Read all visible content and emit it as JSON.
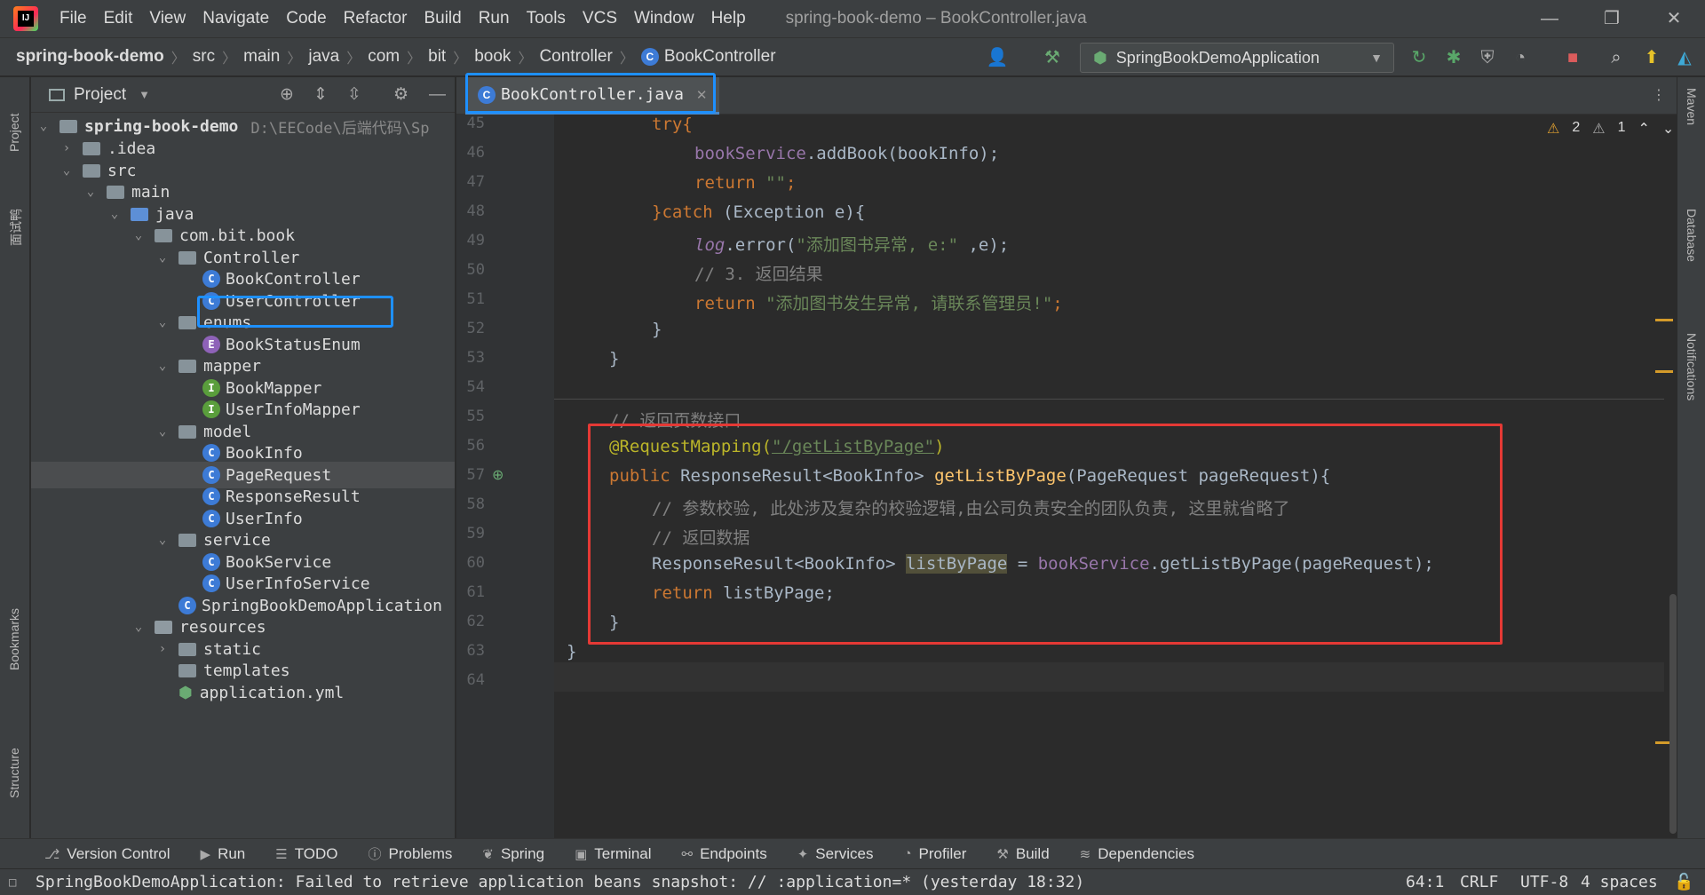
{
  "app": {
    "logo_text": "IJ",
    "window_title": "spring-book-demo – BookController.java"
  },
  "menu": [
    "File",
    "Edit",
    "View",
    "Navigate",
    "Code",
    "Refactor",
    "Build",
    "Run",
    "Tools",
    "VCS",
    "Window",
    "Help"
  ],
  "window_controls": {
    "minimize": "—",
    "restore": "❐",
    "close": "✕"
  },
  "breadcrumbs": [
    "spring-book-demo",
    "src",
    "main",
    "java",
    "com",
    "bit",
    "book",
    "Controller",
    "BookController"
  ],
  "run_config": "SpringBookDemoApplication",
  "left_strip": {
    "project": "Project",
    "bookmarks": "Bookmarks",
    "structure": "Structure",
    "extra": "面试鸭"
  },
  "right_strip": {
    "maven": "Maven",
    "database": "Database",
    "notifications": "Notifications"
  },
  "project_panel": {
    "title": "Project",
    "root": {
      "name": "spring-book-demo",
      "path": "D:\\EECode\\后端代码\\Sp"
    },
    "items": [
      {
        "label": ".idea"
      },
      {
        "label": "src"
      },
      {
        "label": "main"
      },
      {
        "label": "java"
      },
      {
        "label": "com.bit.book"
      },
      {
        "label": "Controller"
      },
      {
        "label": "BookController"
      },
      {
        "label": "UserController"
      },
      {
        "label": "enums"
      },
      {
        "label": "BookStatusEnum"
      },
      {
        "label": "mapper"
      },
      {
        "label": "BookMapper"
      },
      {
        "label": "UserInfoMapper"
      },
      {
        "label": "model"
      },
      {
        "label": "BookInfo"
      },
      {
        "label": "PageRequest"
      },
      {
        "label": "ResponseResult"
      },
      {
        "label": "UserInfo"
      },
      {
        "label": "service"
      },
      {
        "label": "BookService"
      },
      {
        "label": "UserInfoService"
      },
      {
        "label": "SpringBookDemoApplication"
      },
      {
        "label": "resources"
      },
      {
        "label": "static"
      },
      {
        "label": "templates"
      },
      {
        "label": "application.yml"
      }
    ]
  },
  "editor": {
    "tab": "BookController.java",
    "warnings": {
      "warn_count": "2",
      "weak_count": "1"
    },
    "line_numbers": [
      "45",
      "46",
      "47",
      "48",
      "49",
      "50",
      "51",
      "52",
      "53",
      "54",
      "55",
      "56",
      "57",
      "58",
      "59",
      "60",
      "61",
      "62",
      "63",
      "64"
    ],
    "lines": {
      "l45": "try{",
      "l46a": "bookService",
      "l46b": ".addBook(bookInfo);",
      "l47a": "return ",
      "l47b": "\"\"",
      "l47c": ";",
      "l48a": "}catch ",
      "l48b": "(Exception e){",
      "l49a": "log",
      "l49b": ".error(",
      "l49c": "\"添加图书异常, e:\"",
      "l49d": " ,e);",
      "l50": "// 3. 返回结果",
      "l51a": "return ",
      "l51b": "\"添加图书发生异常, 请联系管理员!\"",
      "l51c": ";",
      "l52": "}",
      "l53": "}",
      "l55": "// 返回页数接口",
      "l56a": "@RequestMapping(",
      "l56b": "\"/getListByPage\"",
      "l56c": ")",
      "l57a": "public ",
      "l57b": "ResponseResult<BookInfo> ",
      "l57c": "getListByPage",
      "l57d": "(PageRequest pageRequest){",
      "l58": "// 参数校验, 此处涉及复杂的校验逻辑,由公司负责安全的团队负责, 这里就省略了",
      "l59": "// 返回数据",
      "l60a": "ResponseResult<BookInfo> ",
      "l60b": "listByPage",
      "l60c": " = ",
      "l60d": "bookService",
      "l60e": ".getListByPage(pageRequest);",
      "l61a": "return ",
      "l61b": "listByPage;",
      "l62": "}",
      "l63": "}"
    }
  },
  "tool_windows": [
    "Version Control",
    "Run",
    "TODO",
    "Problems",
    "Spring",
    "Terminal",
    "Endpoints",
    "Services",
    "Profiler",
    "Build",
    "Dependencies"
  ],
  "status": {
    "message": "SpringBookDemoApplication: Failed to retrieve application beans snapshot: // :application=* (yesterday 18:32)",
    "position": "64:1",
    "line_sep": "CRLF",
    "encoding": "UTF-8",
    "indent": "4 spaces"
  },
  "colors": {
    "highlight_blue": "#1e90ff",
    "highlight_red": "#e53935",
    "keyword": "#cc7832",
    "string": "#6a8759"
  }
}
